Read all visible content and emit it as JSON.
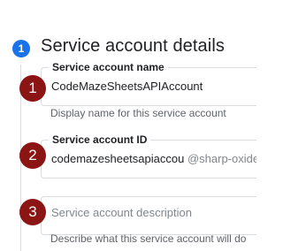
{
  "section": {
    "step_number": "1",
    "title": "Service account details"
  },
  "fields": [
    {
      "label": "Service account name",
      "value": "CodeMazeSheetsAPIAccount",
      "hint": "Display name for this service account"
    },
    {
      "label": "Service account ID",
      "value": "codemazesheetsapiaccou",
      "suffix": "@sharp-oxide"
    },
    {
      "placeholder": "Service account description",
      "hint": "Describe what this service account will do"
    }
  ],
  "annotations": [
    "1",
    "2",
    "3"
  ],
  "colors": {
    "step_badge": "#1a73e8",
    "annotation_marker": "#8b1414",
    "border": "#dadce0"
  }
}
